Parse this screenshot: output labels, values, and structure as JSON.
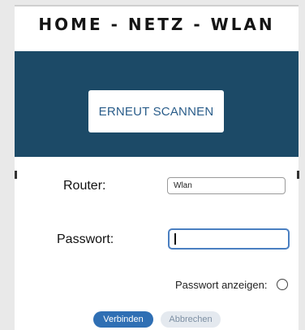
{
  "header": {
    "title": "HOME - NETZ - WLAN"
  },
  "scan": {
    "rescan_label": "ERNEUT SCANNEN"
  },
  "form": {
    "router_label": "Router:",
    "router_value": "Wlan",
    "password_label": "Passwort:",
    "password_value": "",
    "show_password_label": "Passwort anzeigen:"
  },
  "actions": {
    "connect_label": "Verbinden",
    "cancel_label": "Abbrechen"
  },
  "colors": {
    "banner": "#1c4a67",
    "primary_button": "#2f6fb4",
    "focus_border": "#4a7fc1"
  }
}
